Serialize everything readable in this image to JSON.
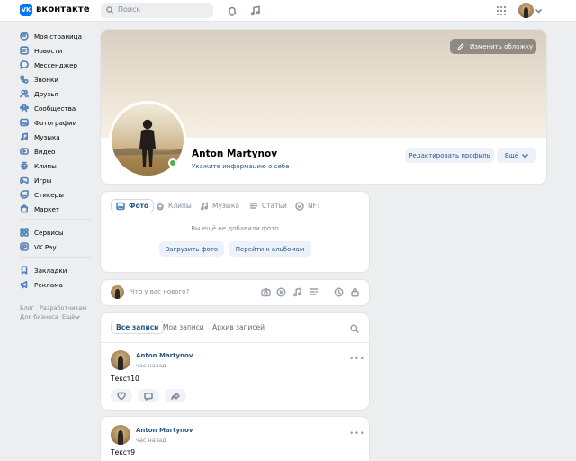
{
  "header": {
    "logo_mark": "VK",
    "logo_text": "вконтакте",
    "search_placeholder": "Поиск",
    "icons": [
      "search-icon",
      "bell-icon",
      "music-note-icon",
      "apps-grid-icon",
      "chevron-down-icon"
    ]
  },
  "sidebar": {
    "items": [
      {
        "label": "Моя страница",
        "icon": "user-icon"
      },
      {
        "label": "Новости",
        "icon": "news-icon"
      },
      {
        "label": "Мессенджер",
        "icon": "chat-bubble-icon"
      },
      {
        "label": "Звонки",
        "icon": "phone-icon"
      },
      {
        "label": "Друзья",
        "icon": "friends-icon"
      },
      {
        "label": "Сообщества",
        "icon": "groups-icon"
      },
      {
        "label": "Фотографии",
        "icon": "photo-icon"
      },
      {
        "label": "Музыка",
        "icon": "music-icon"
      },
      {
        "label": "Видео",
        "icon": "video-icon"
      },
      {
        "label": "Клипы",
        "icon": "clips-icon"
      },
      {
        "label": "Игры",
        "icon": "gamepad-icon"
      },
      {
        "label": "Стикеры",
        "icon": "sticker-icon"
      },
      {
        "label": "Маркет",
        "icon": "market-icon"
      }
    ],
    "extra_items": [
      {
        "label": "Сервисы",
        "icon": "services-icon"
      },
      {
        "label": "VK Pay",
        "icon": "vk-pay-icon"
      }
    ],
    "bottom_items": [
      {
        "label": "Закладки",
        "icon": "bookmark-icon"
      },
      {
        "label": "Реклама",
        "icon": "megaphone-icon"
      }
    ],
    "footer": {
      "links": [
        "Блог",
        "Разработчикам",
        "Для бизнеса",
        "Ещё"
      ]
    }
  },
  "profile": {
    "cover_button": "Изменить обложку",
    "name": "Anton Martynov",
    "info_link": "Укажите информацию о себе",
    "edit_button": "Редактировать профиль",
    "more_button": "Ещё",
    "online": true
  },
  "media": {
    "tabs": [
      {
        "label": "Фото",
        "icon": "photo-icon"
      },
      {
        "label": "Клипы",
        "icon": "clips-icon"
      },
      {
        "label": "Музыка",
        "icon": "music-icon"
      },
      {
        "label": "Статьи",
        "icon": "article-icon"
      },
      {
        "label": "NFT",
        "icon": "nft-icon"
      }
    ],
    "empty_text": "Вы ещё не добавили фото",
    "upload_button": "Загрузить фото",
    "albums_button": "Перейти к альбомам"
  },
  "composer": {
    "placeholder": "Что у вас нового?",
    "icons": [
      "camera-icon",
      "video-icon",
      "music-icon",
      "article-icon",
      "clock-icon",
      "lock-icon"
    ]
  },
  "wall": {
    "tabs": [
      "Все записи",
      "Мои записи",
      "Архив записей"
    ],
    "posts": [
      {
        "author": "Anton Martynov",
        "time": "час назад",
        "text": "Текст10"
      },
      {
        "author": "Anton Martynov",
        "time": "час назад",
        "text": "Текст9"
      }
    ]
  }
}
